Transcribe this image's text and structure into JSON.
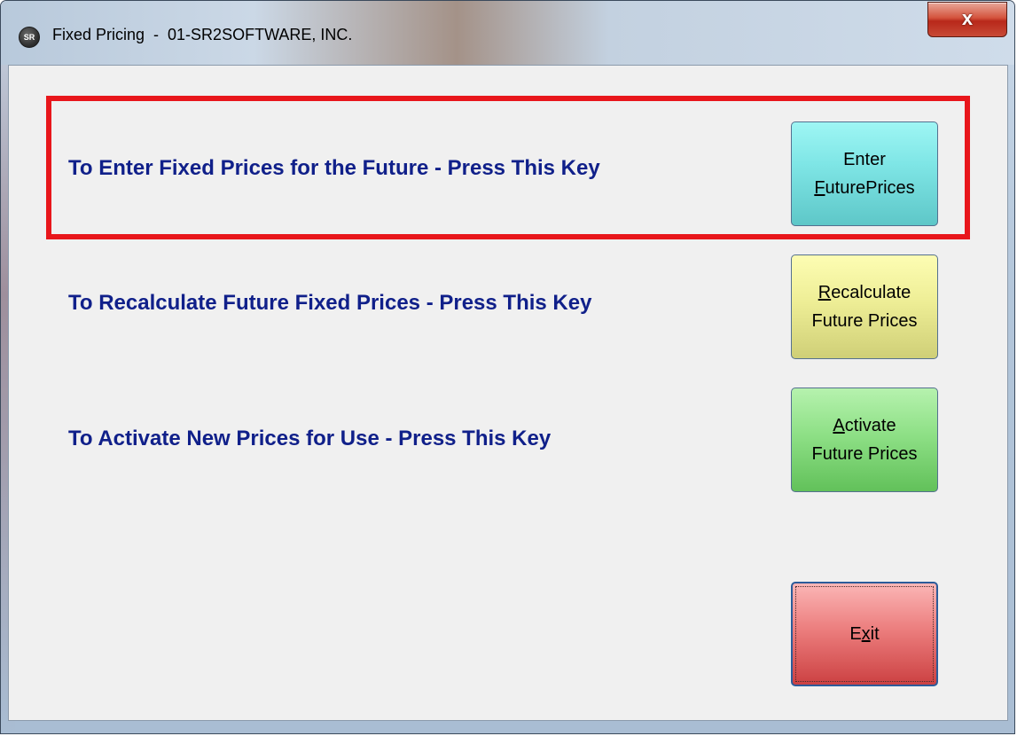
{
  "window": {
    "title": "Fixed Pricing  -  01-SR2SOFTWARE, INC.",
    "app_icon_text": "SR",
    "close_glyph": "x"
  },
  "rows": [
    {
      "label": "To Enter Fixed Prices for the Future - Press This Key",
      "button_line1": "Enter",
      "button_line2_mnemonic": "F",
      "button_line2_rest": "uturePrices",
      "highlighted": true
    },
    {
      "label": "To Recalculate Future Fixed Prices - Press This Key",
      "button_line1_mnemonic": "R",
      "button_line1_rest": "ecalculate",
      "button_line2": "Future Prices"
    },
    {
      "label": "To Activate New Prices for Use - Press This Key",
      "button_line1_mnemonic": "A",
      "button_line1_rest": "ctivate",
      "button_line2": "Future Prices"
    }
  ],
  "exit_button": {
    "pre": "E",
    "mnemonic": "x",
    "post": "it"
  },
  "colors": {
    "label_text": "#10208a",
    "highlight_border": "#e8161b",
    "enter_button": "#7fe6e6",
    "recalculate_button": "#eeee96",
    "activate_button": "#8ee086",
    "exit_button": "#ec7e7e"
  },
  "icons": {
    "app": "sr2-app-icon",
    "close": "close-icon"
  }
}
